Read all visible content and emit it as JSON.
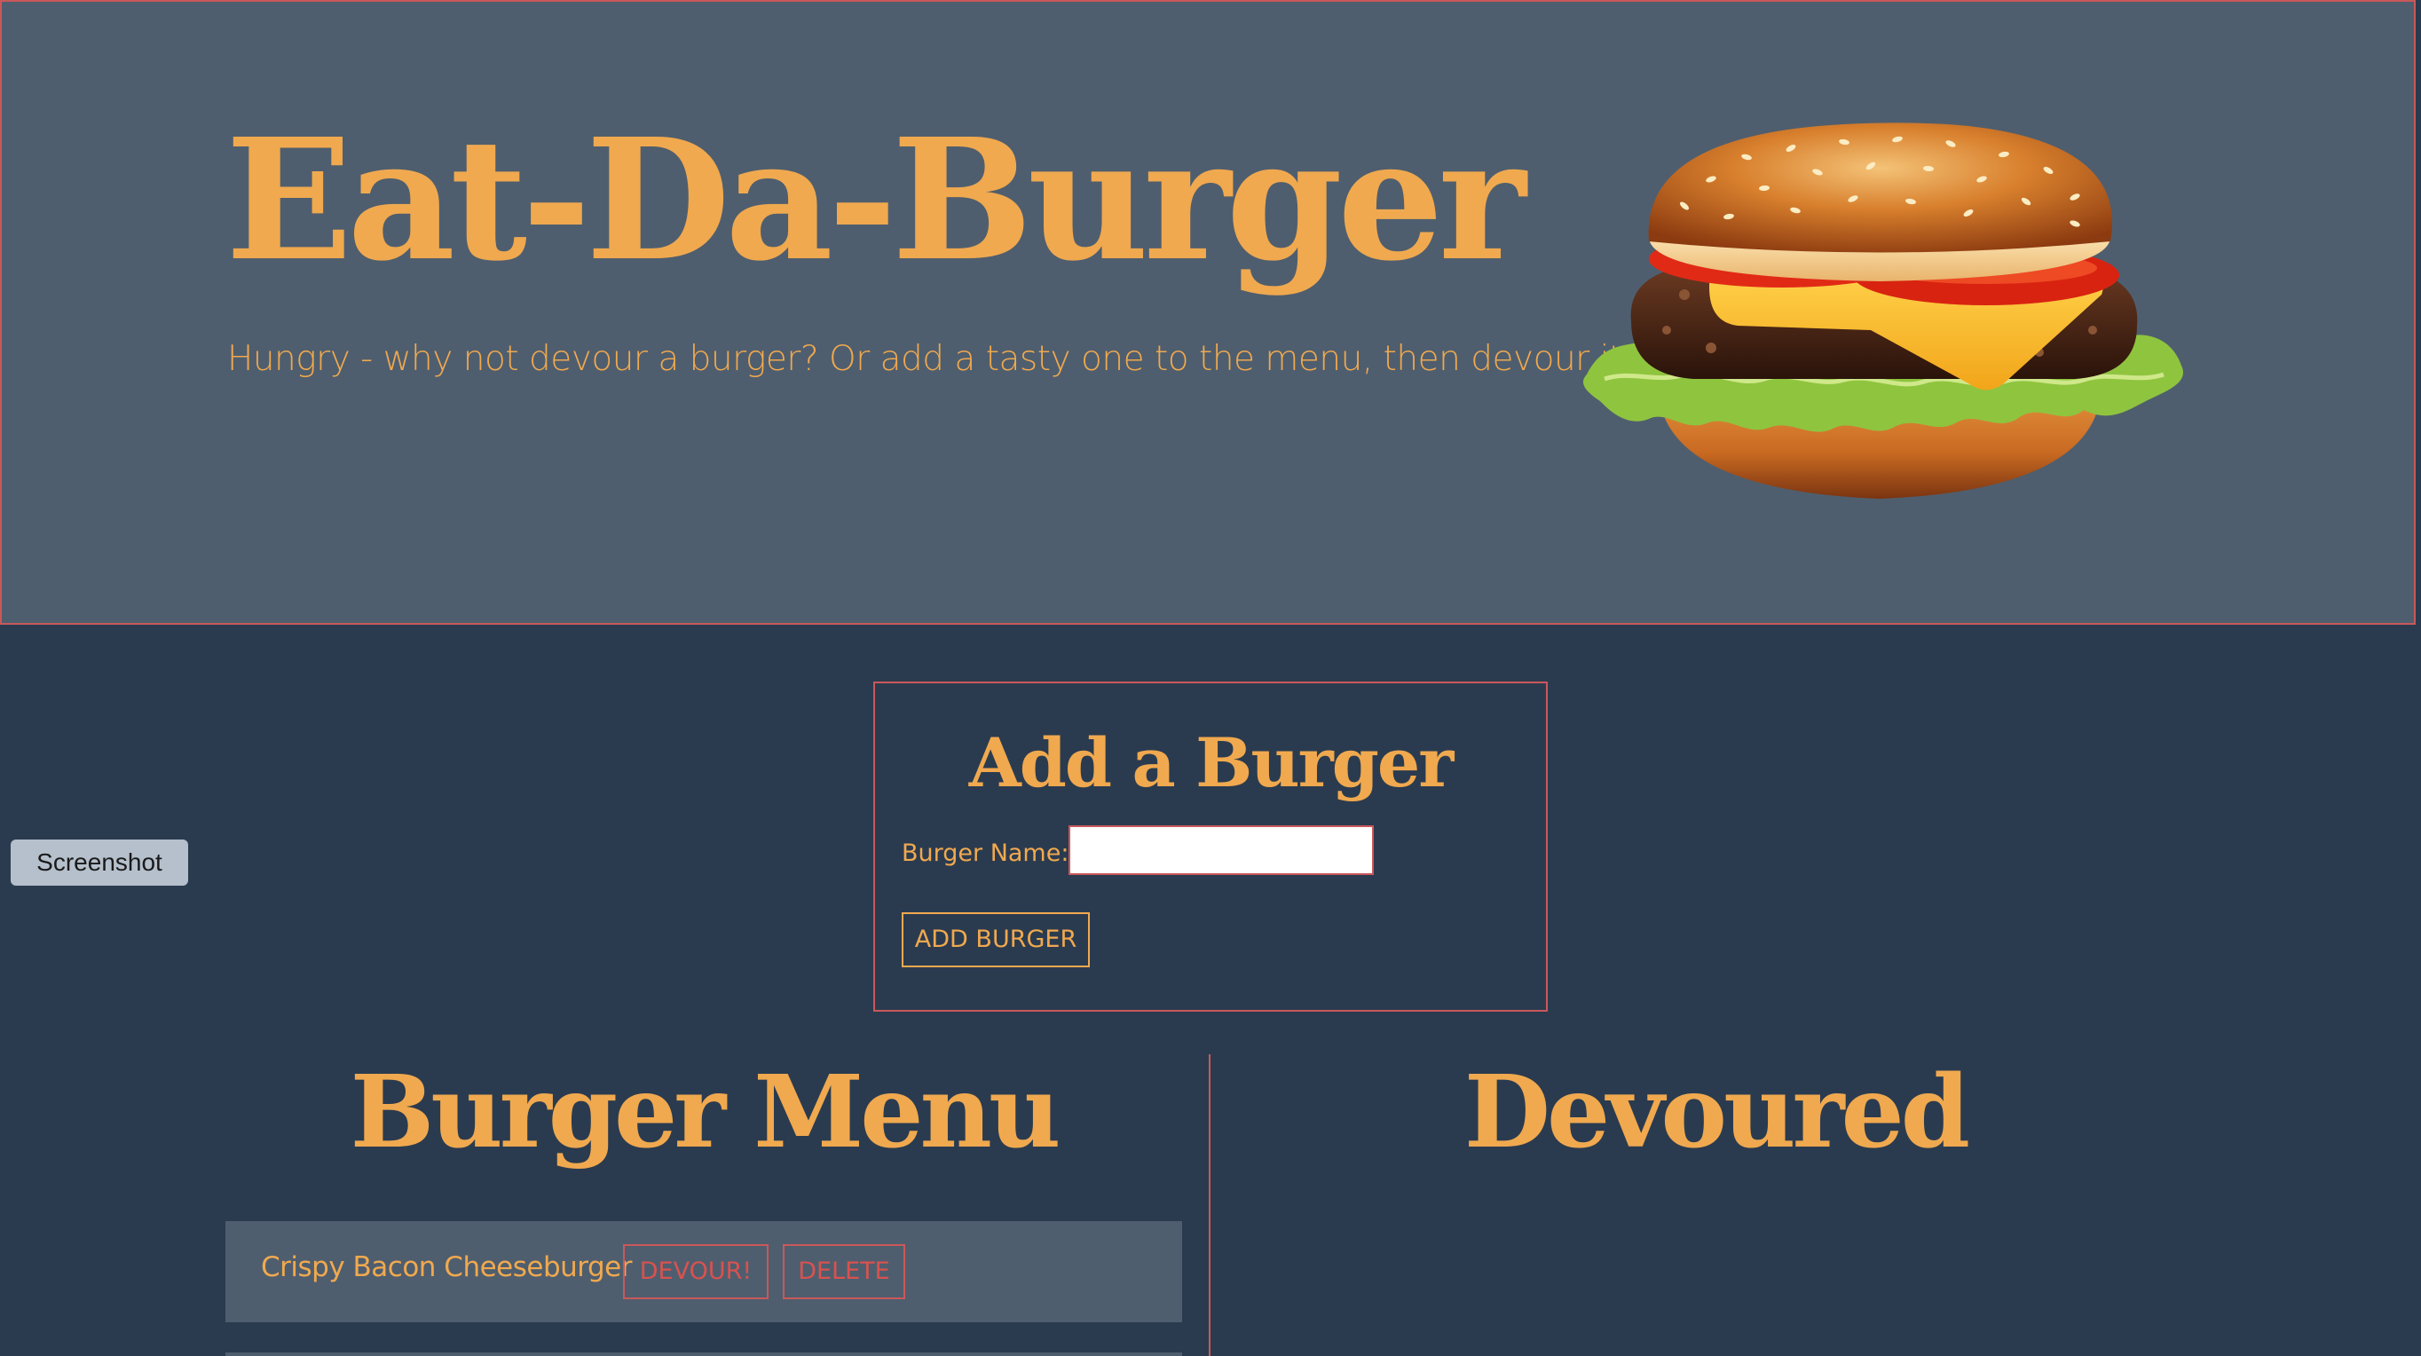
{
  "hero": {
    "title": "Eat-Da-Burger",
    "subtitle": "Hungry - why not devour a burger? Or add a tasty one to the menu, then devour it!"
  },
  "side_button": {
    "label": "Screenshot"
  },
  "add_form": {
    "title": "Add a Burger",
    "name_label": "Burger Name:",
    "name_value": "",
    "submit_label": "ADD BURGER"
  },
  "menu": {
    "title": "Burger Menu",
    "items": [
      {
        "name": "Crispy Bacon Cheeseburger",
        "devour_label": "DEVOUR!",
        "delete_label": "DELETE"
      }
    ]
  },
  "devoured": {
    "title": "Devoured",
    "items": []
  },
  "colors": {
    "hero_bg": "#4f5e6e",
    "page_bg": "#2b3b4f",
    "accent": "#f0a94f",
    "border": "#c9585a"
  },
  "icons": {
    "hero_image": "burger-icon"
  }
}
